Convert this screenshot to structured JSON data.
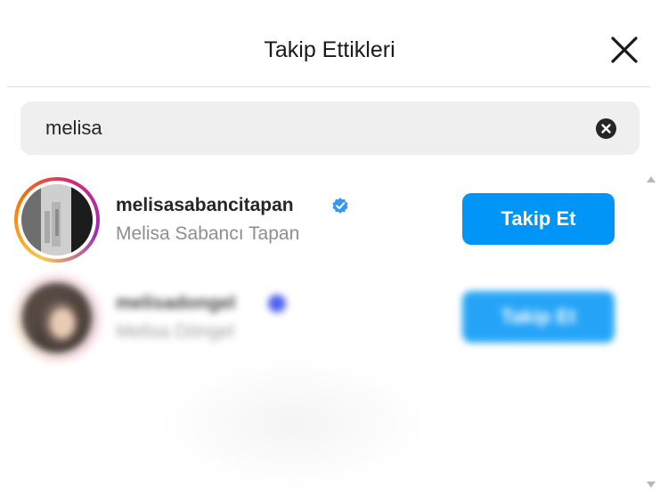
{
  "header": {
    "title": "Takip Ettikleri",
    "close_icon": "close-icon"
  },
  "search": {
    "value": "melisa",
    "clear_icon": "clear-circle-icon"
  },
  "results": [
    {
      "username": "melisasabancitapan",
      "full_name": "Melisa Sabancı Tapan",
      "verified": true,
      "button_label": "Takip Et"
    },
    {
      "username": "melisadongel",
      "full_name": "Melisa Döngel",
      "verified": true,
      "button_label": "Takip Et",
      "blurred": true
    }
  ],
  "colors": {
    "primary": "#0095f6",
    "verified_badge": "#3897f0",
    "secondary_text": "#8e8e8e"
  }
}
